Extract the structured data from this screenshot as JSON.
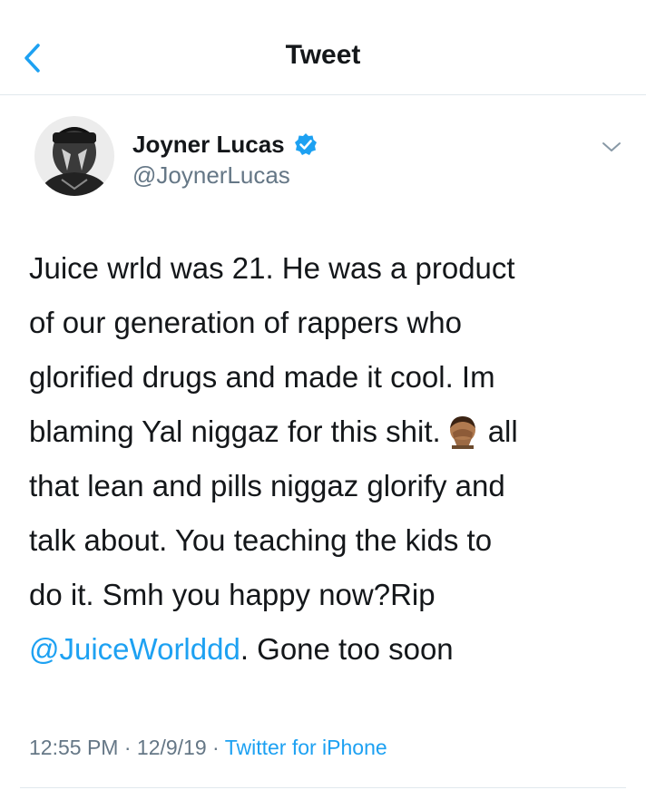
{
  "header": {
    "title": "Tweet",
    "back_icon": "chevron-left-icon"
  },
  "author": {
    "name": "Joyner Lucas",
    "handle": "@JoynerLucas",
    "verified": true,
    "verified_icon": "verified-badge-icon",
    "menu_icon": "chevron-down-icon"
  },
  "tweet": {
    "lines": [
      "Juice wrld was 21. He was a product",
      "of our generation of rappers who",
      "glorified drugs and made it cool. Im",
      "blaming Yal niggaz for this shit.",
      "all",
      "that lean and pills niggaz glorify and",
      "talk about. You teaching the kids to",
      "do it. Smh you happy now?Rip",
      ". Gone too soon"
    ],
    "emoji": "facepalm-emoji",
    "mention": "@JuiceWorlddd"
  },
  "meta": {
    "time": "12:55 PM",
    "separator": "·",
    "date": "12/9/19",
    "source": "Twitter for iPhone"
  },
  "colors": {
    "accent": "#1da1f2",
    "text": "#14171a",
    "secondary": "#657786",
    "divider": "#e1e8ed"
  }
}
